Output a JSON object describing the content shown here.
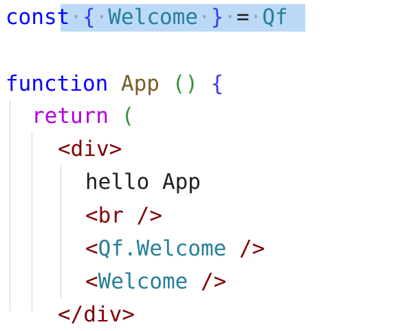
{
  "editor": {
    "lines": [
      {
        "tokens": [
          "const",
          " ",
          "{",
          " ",
          "Welcome",
          " ",
          "}",
          " ",
          "=",
          " ",
          "Qf"
        ]
      },
      {
        "tokens": [
          "function",
          " ",
          "App",
          " ",
          "()",
          " ",
          "{"
        ]
      },
      {
        "tokens": [
          "return",
          " ",
          "("
        ]
      },
      {
        "tokens": [
          "<div>"
        ]
      },
      {
        "tokens": [
          "hello App"
        ]
      },
      {
        "tokens": [
          "<br />"
        ]
      },
      {
        "tokens": [
          "<Qf.Welcome />"
        ]
      },
      {
        "tokens": [
          "<Welcome />"
        ]
      },
      {
        "tokens": [
          "</div>"
        ]
      }
    ],
    "line1": {
      "kw_const": "const",
      "brace_open": "{",
      "welcome": "Welcome",
      "brace_close": "}",
      "equals": "=",
      "qf": "Qf",
      "dot": "·"
    },
    "line2": {
      "kw_function": "function",
      "name": "App",
      "parens": "()",
      "brace": "{"
    },
    "line3": {
      "kw_return": "return",
      "paren": "("
    },
    "line4": {
      "tag": "<div>"
    },
    "line5": {
      "text": "hello App"
    },
    "line6": {
      "tag": "<br />"
    },
    "line7": {
      "open": "<",
      "component": "Qf.Welcome",
      "close": " />"
    },
    "line8": {
      "open": "<",
      "component": "Welcome",
      "close": " />"
    },
    "line9": {
      "tag": "</div>"
    }
  },
  "colors": {
    "keyword": "#0000ff",
    "control_keyword": "#af00db",
    "function_name": "#795e26",
    "variable": "#267f99",
    "jsx_tag": "#800000",
    "selection": "#bcd9f7"
  }
}
